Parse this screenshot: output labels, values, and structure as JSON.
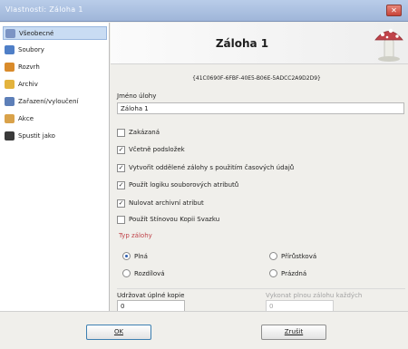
{
  "window": {
    "title": "Vlastnosti: Záloha 1",
    "close_symbol": "✕"
  },
  "sidebar": {
    "items": [
      {
        "label": "Všeobecné",
        "icon": "clipboard-icon",
        "color": "#7c94c4",
        "selected": true
      },
      {
        "label": "Soubory",
        "icon": "files-icon",
        "color": "#4f7fc7"
      },
      {
        "label": "Rozvrh",
        "icon": "calendar-icon",
        "color": "#d98b2b"
      },
      {
        "label": "Archiv",
        "icon": "archive-icon",
        "color": "#e3b33d"
      },
      {
        "label": "Zařazení/vyloučení",
        "icon": "filter-icon",
        "color": "#5d7fb8"
      },
      {
        "label": "Akce",
        "icon": "actions-icon",
        "color": "#d9a24a"
      },
      {
        "label": "Spustit jako",
        "icon": "user-icon",
        "color": "#3a3a3a"
      }
    ]
  },
  "header": {
    "title": "Záloha 1"
  },
  "guid": "{41C0690F-6FBF-40E5-B06E-5ADCC2A9D2D9}",
  "task_name": {
    "label": "Jméno úlohy",
    "value": "Záloha 1"
  },
  "options": [
    {
      "label": "Zakázaná",
      "checked": false
    },
    {
      "label": "Včetně podsložek",
      "checked": true
    },
    {
      "label": "Vytvořit oddělené zálohy s použitím časových údajů",
      "checked": true
    },
    {
      "label": "Použít logiku souborových atributů",
      "checked": true
    },
    {
      "label": "Nulovat archivní atribut",
      "checked": true
    },
    {
      "label": "Použít Stínovou Kopii Svazku",
      "checked": false
    }
  ],
  "backup_type": {
    "label": "Typ zálohy",
    "options": [
      {
        "label": "Plná",
        "selected": true
      },
      {
        "label": "Přírůstková",
        "selected": false
      },
      {
        "label": "Rozdílová",
        "selected": false
      },
      {
        "label": "Prázdná",
        "selected": false
      }
    ]
  },
  "keep_full": {
    "label": "Udržovat úplné kopie",
    "value": "0"
  },
  "full_every": {
    "label": "Vykonat plnou zálohu každých",
    "value": "0"
  },
  "buttons": {
    "ok": "OK",
    "cancel": "Zrušit"
  },
  "colors": {
    "accent_red": "#c0434a",
    "selection": "#c9dcf3",
    "disabled_text": "#a3a3a3"
  }
}
